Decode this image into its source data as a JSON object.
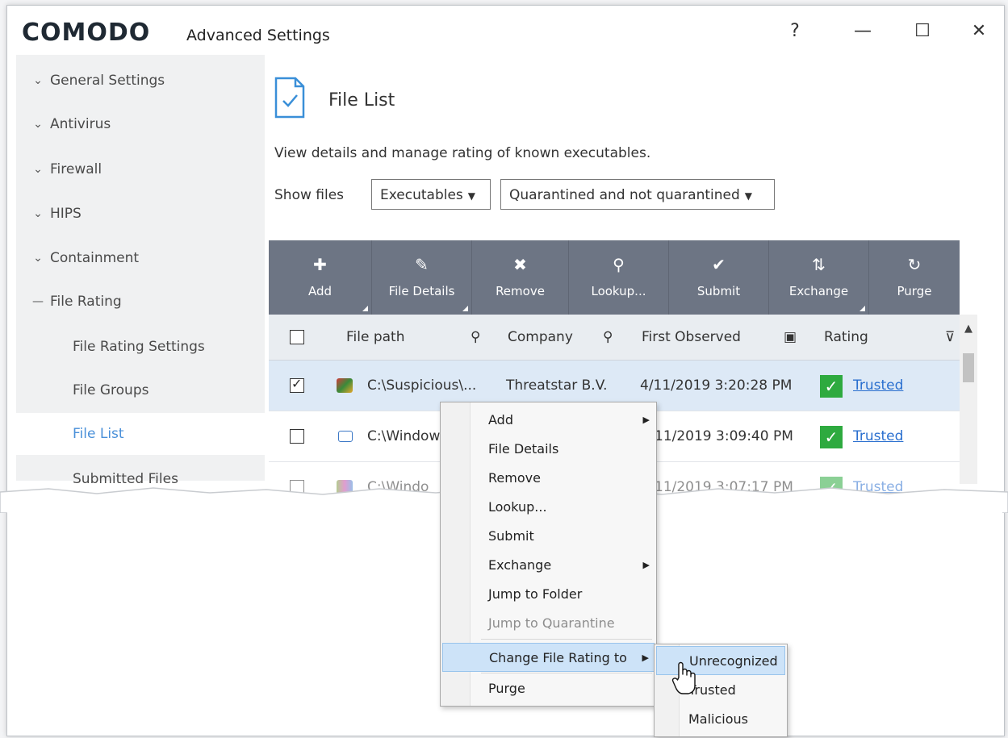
{
  "titlebar": {
    "logo": "COMODO",
    "title": "Advanced Settings",
    "help": "?",
    "minimize": "—",
    "maximize": "☐",
    "close": "✕"
  },
  "sidebar": {
    "items": [
      {
        "label": "General Settings",
        "icon": "chevron-down-icon"
      },
      {
        "label": "Antivirus",
        "icon": "chevron-down-icon"
      },
      {
        "label": "Firewall",
        "icon": "chevron-down-icon"
      },
      {
        "label": "HIPS",
        "icon": "chevron-down-icon"
      },
      {
        "label": "Containment",
        "icon": "chevron-down-icon"
      },
      {
        "label": "File Rating",
        "icon": "collapse-dash-icon"
      }
    ],
    "subitems": [
      {
        "label": "File Rating Settings"
      },
      {
        "label": "File Groups"
      },
      {
        "label": "File List",
        "active": true
      },
      {
        "label": "Submitted Files"
      }
    ]
  },
  "main": {
    "title": "File List",
    "description": "View details and manage rating of known executables.",
    "show_files_label": "Show files",
    "filter_type": "Executables",
    "filter_quarantine": "Quarantined and not quarantined"
  },
  "toolbar": [
    {
      "label": "Add",
      "icon": "plus-icon"
    },
    {
      "label": "File Details",
      "icon": "pencil-icon"
    },
    {
      "label": "Remove",
      "icon": "x-icon"
    },
    {
      "label": "Lookup...",
      "icon": "magnifier-icon"
    },
    {
      "label": "Submit",
      "icon": "check-icon"
    },
    {
      "label": "Exchange",
      "icon": "exchange-icon"
    },
    {
      "label": "Purge",
      "icon": "refresh-icon"
    }
  ],
  "table": {
    "headers": [
      "File path",
      "Company",
      "First Observed",
      "Rating"
    ],
    "rows": [
      {
        "path": "C:\\Suspicious\\...",
        "company": "Threatstar B.V.",
        "observed": "4/11/2019 3:20:28 PM",
        "rating": "Trusted",
        "checked": true
      },
      {
        "path": "C:\\Window",
        "company": "",
        "observed": "11/2019 3:09:40 PM",
        "rating": "Trusted",
        "checked": false
      },
      {
        "path": "C:\\Windo",
        "company": "",
        "observed": "11/2019 3:07:17 PM",
        "rating": "Trusted",
        "checked": false
      }
    ]
  },
  "context_menu": {
    "items": [
      {
        "label": "Add",
        "submenu": true
      },
      {
        "label": "File Details"
      },
      {
        "label": "Remove"
      },
      {
        "label": "Lookup..."
      },
      {
        "label": "Submit"
      },
      {
        "label": "Exchange",
        "submenu": true
      },
      {
        "label": "Jump to Folder"
      },
      {
        "label": "Jump to Quarantine",
        "disabled": true
      },
      {
        "label": "Change File Rating to",
        "submenu": true,
        "highlighted": true
      },
      {
        "label": "Purge"
      }
    ],
    "submenu_arrow": "▶"
  },
  "rating_submenu": {
    "items": [
      {
        "label": "Unrecognized",
        "highlighted": true
      },
      {
        "label": "Trusted"
      },
      {
        "label": "Malicious"
      }
    ]
  },
  "colors": {
    "toolbar_bg": "#6d7584",
    "selected_row": "#dde9f6",
    "trusted_green": "#2eaa3f",
    "link_blue": "#2a6fcf",
    "menu_highlight": "#cde3f8"
  }
}
